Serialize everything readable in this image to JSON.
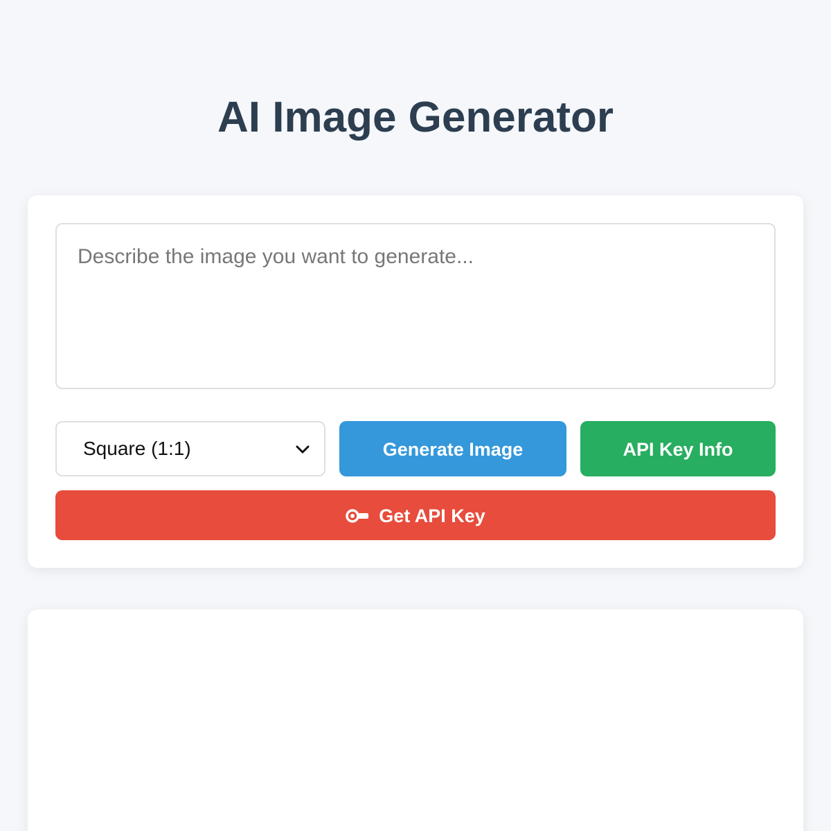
{
  "header": {
    "title": "AI Image Generator"
  },
  "form": {
    "prompt_placeholder": "Describe the image you want to generate...",
    "prompt_value": "",
    "aspect_ratio_selected": "Square (1:1)",
    "generate_label": "Generate Image",
    "api_info_label": "API Key Info",
    "get_key_label": "Get API Key"
  },
  "icons": {
    "select": "chevron-down-icon",
    "get_key": "key-icon"
  },
  "colors": {
    "background": "#f5f7fa",
    "title": "#2c3e50",
    "generate": "#3498db",
    "api_info": "#27ae60",
    "get_key": "#e74c3c"
  }
}
